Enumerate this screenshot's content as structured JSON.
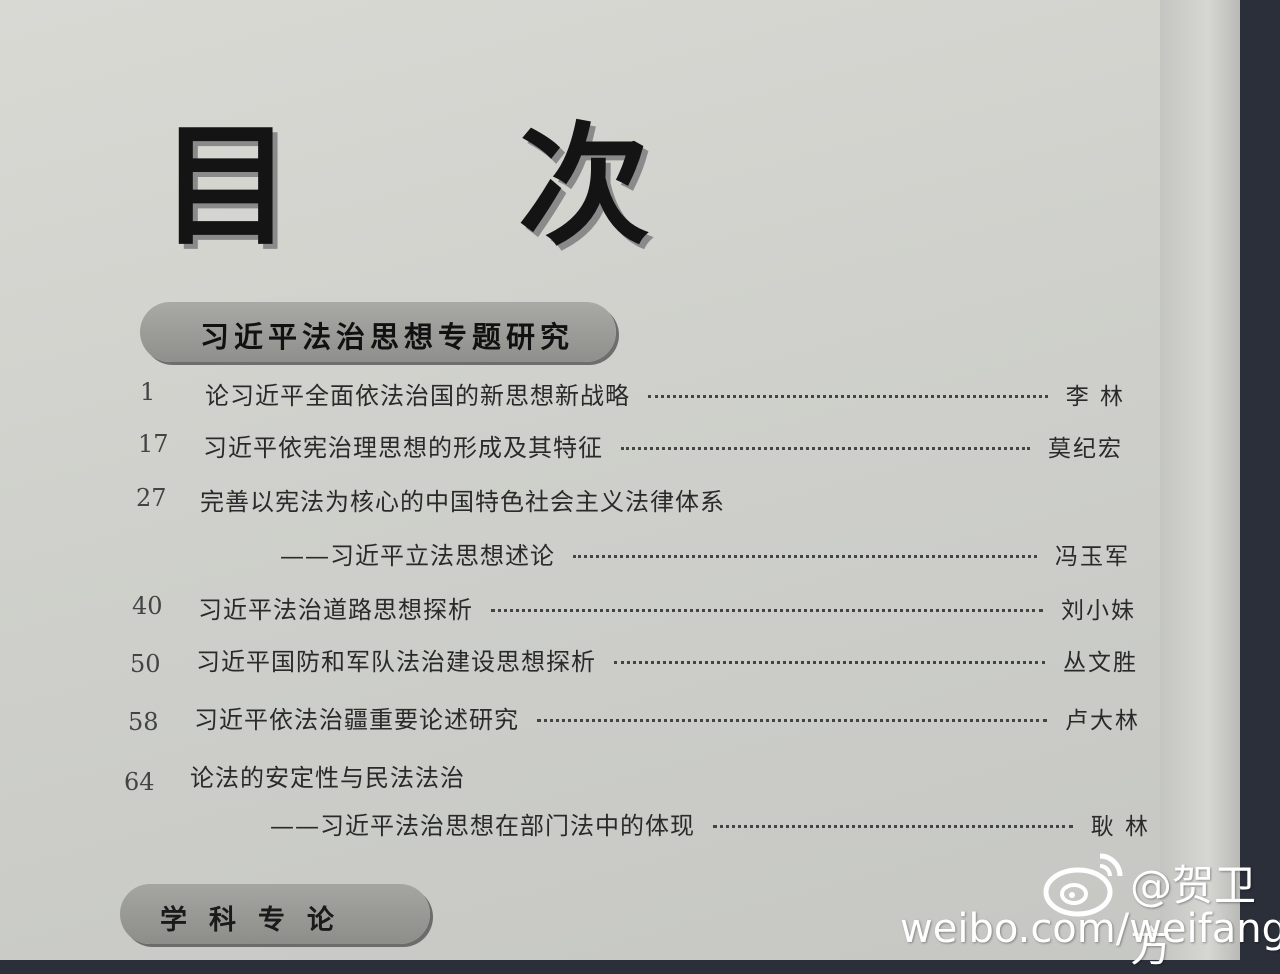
{
  "heading": "目 次",
  "section": {
    "title": "习近平法治思想专题研究"
  },
  "entries": [
    {
      "page": "1",
      "title": "论习近平全面依法治国的新思想新战略",
      "subtitle": "",
      "author": "李 林"
    },
    {
      "page": "17",
      "title": "习近平依宪治理思想的形成及其特征",
      "subtitle": "",
      "author": "莫纪宏"
    },
    {
      "page": "27",
      "title": "完善以宪法为核心的中国特色社会主义法律体系",
      "subtitle": "——习近平立法思想述论",
      "author": "冯玉军"
    },
    {
      "page": "40",
      "title": "习近平法治道路思想探析",
      "subtitle": "",
      "author": "刘小妹"
    },
    {
      "page": "50",
      "title": "习近平国防和军队法治建设思想探析",
      "subtitle": "",
      "author": "丛文胜"
    },
    {
      "page": "58",
      "title": "习近平依法治疆重要论述研究",
      "subtitle": "",
      "author": "卢大林"
    },
    {
      "page": "64",
      "title": "论法的安定性与民法法治",
      "subtitle": "——习近平法治思想在部门法中的体现",
      "author": "耿 林"
    }
  ],
  "bottom_section": {
    "title": "学科专论"
  },
  "watermark": {
    "handle": "@贺卫方",
    "url": "weibo.com/weifanghe",
    "icon": "weibo-logo-icon"
  },
  "colors": {
    "paper": "#d6d6d1",
    "ink": "#1a1a1a",
    "bar": "#9e9e9b",
    "watermark": "#ffffff"
  }
}
